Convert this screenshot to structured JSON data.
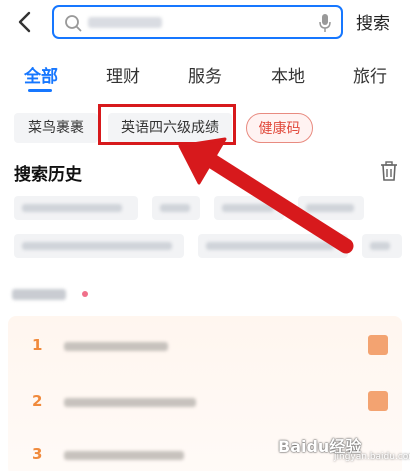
{
  "search": {
    "placeholder": "",
    "button_label": "搜索"
  },
  "tabs": [
    {
      "label": "全部"
    },
    {
      "label": "理财"
    },
    {
      "label": "服务"
    },
    {
      "label": "本地"
    },
    {
      "label": "旅行"
    }
  ],
  "chips": [
    {
      "label": "菜鸟裹裹"
    },
    {
      "label": "英语四六级成绩"
    },
    {
      "label": "健康码"
    }
  ],
  "history": {
    "title": "搜索历史"
  },
  "hot_list": {
    "ranks": [
      "1",
      "2",
      "3"
    ]
  },
  "watermark": {
    "text": "Baidu经验",
    "sub": "jingyan.baidu.com"
  },
  "colors": {
    "accent": "#1677ff",
    "highlight": "#d7191c",
    "health_code": "#e14a3c"
  }
}
